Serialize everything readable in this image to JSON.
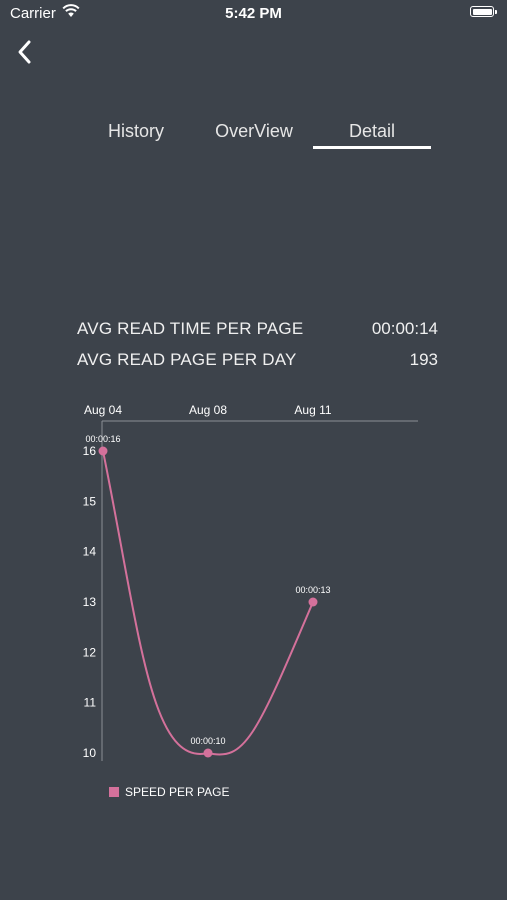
{
  "status_bar": {
    "carrier": "Carrier",
    "time": "5:42 PM"
  },
  "tabs": [
    {
      "label": "History",
      "selected": false
    },
    {
      "label": "OverView",
      "selected": false
    },
    {
      "label": "Detail",
      "selected": true
    }
  ],
  "stats": [
    {
      "label": "AVG READ TIME PER PAGE",
      "value": "00:00:14"
    },
    {
      "label": "AVG READ PAGE PER DAY",
      "value": "193"
    }
  ],
  "colors": {
    "background": "#3d434b",
    "series": "#d4719b",
    "text": "#ffffff"
  },
  "chart_data": {
    "type": "line",
    "categories": [
      "Aug 04",
      "Aug 08",
      "Aug 11"
    ],
    "series": [
      {
        "name": "SPEED PER PAGE",
        "values": [
          16,
          10,
          13
        ],
        "data_labels": [
          "00:00:16",
          "00:00:10",
          "00:00:13"
        ]
      }
    ],
    "y_ticks": [
      16,
      15,
      14,
      13,
      12,
      11,
      10
    ],
    "ylim": [
      10,
      16
    ],
    "x_axis_position": "top",
    "grid": false,
    "legend": "bottom-left",
    "curve": "smooth"
  }
}
